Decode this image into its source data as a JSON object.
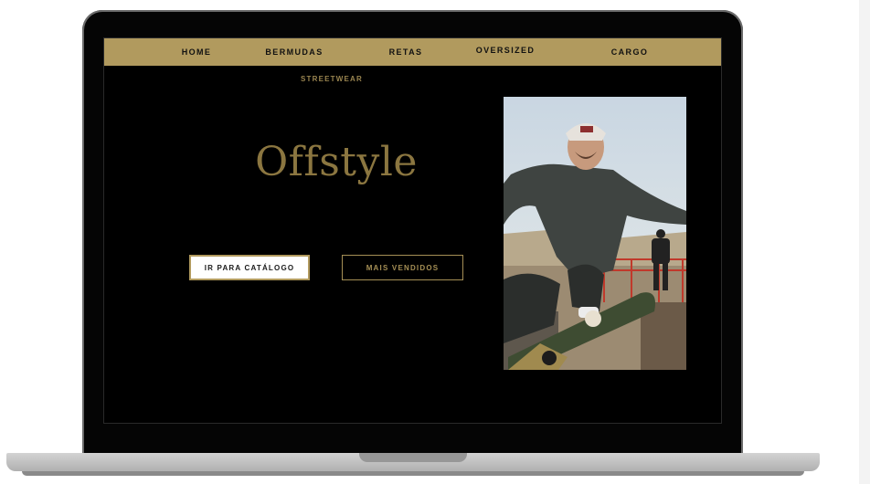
{
  "nav": {
    "items": [
      {
        "label": "HOME"
      },
      {
        "label": "BERMUDAS"
      },
      {
        "label": "RETAS"
      },
      {
        "label": "OVERSIZED"
      },
      {
        "label": "CARGO"
      }
    ],
    "sub_item": "STREETWEAR"
  },
  "hero": {
    "brand": "Offstyle",
    "catalog_button": "IR PARA CATÁLOGO",
    "bestsellers_button": "MAIS VENDIDOS"
  },
  "colors": {
    "accent_gold": "#b19a5e",
    "brand_text": "#8b7640",
    "screen_background": "#000000"
  },
  "icons": [
    "laptop-frame"
  ]
}
